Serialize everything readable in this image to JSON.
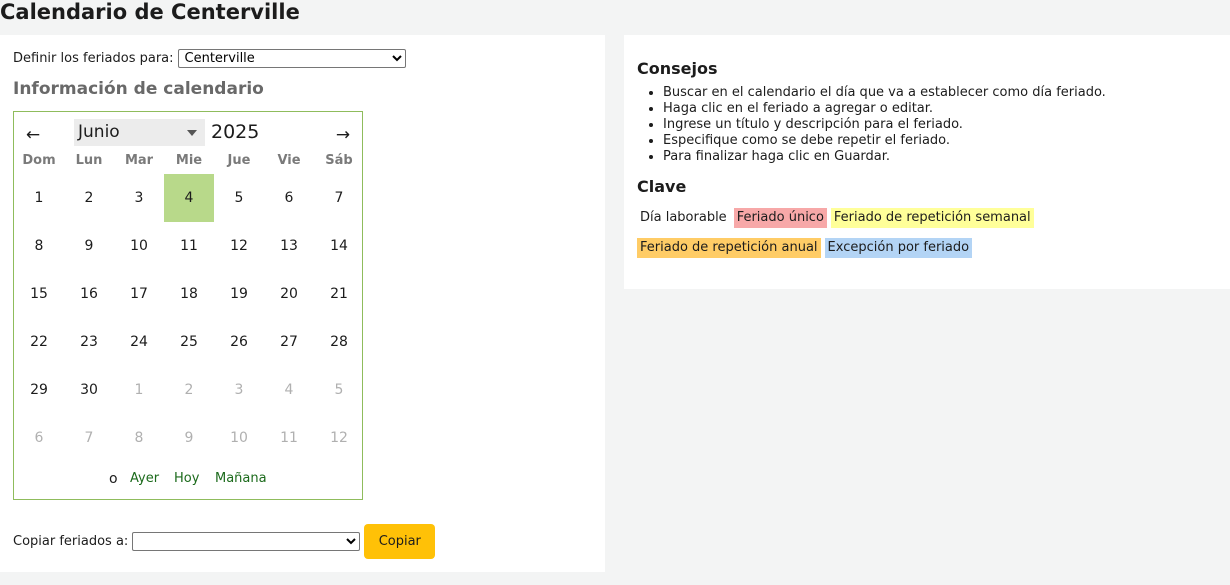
{
  "page_title": "Calendario de Centerville",
  "define": {
    "label": "Definir los feriados para:",
    "selected_library": "Centerville"
  },
  "section_title": "Información de calendario",
  "calendar": {
    "month": "Junio",
    "year": "2025",
    "prev_icon": "arrow-left-icon",
    "next_icon": "arrow-right-icon",
    "weekdays": [
      "Dom",
      "Lun",
      "Mar",
      "Mie",
      "Jue",
      "Vie",
      "Sáb"
    ],
    "weeks": [
      [
        {
          "d": "1"
        },
        {
          "d": "2"
        },
        {
          "d": "3"
        },
        {
          "d": "4",
          "selected": true
        },
        {
          "d": "5"
        },
        {
          "d": "6"
        },
        {
          "d": "7"
        }
      ],
      [
        {
          "d": "8"
        },
        {
          "d": "9"
        },
        {
          "d": "10"
        },
        {
          "d": "11"
        },
        {
          "d": "12"
        },
        {
          "d": "13"
        },
        {
          "d": "14"
        }
      ],
      [
        {
          "d": "15"
        },
        {
          "d": "16"
        },
        {
          "d": "17"
        },
        {
          "d": "18"
        },
        {
          "d": "19"
        },
        {
          "d": "20"
        },
        {
          "d": "21"
        }
      ],
      [
        {
          "d": "22"
        },
        {
          "d": "23"
        },
        {
          "d": "24"
        },
        {
          "d": "25"
        },
        {
          "d": "26"
        },
        {
          "d": "27"
        },
        {
          "d": "28"
        }
      ],
      [
        {
          "d": "29"
        },
        {
          "d": "30"
        },
        {
          "d": "1",
          "other": true
        },
        {
          "d": "2",
          "other": true
        },
        {
          "d": "3",
          "other": true
        },
        {
          "d": "4",
          "other": true
        },
        {
          "d": "5",
          "other": true
        }
      ],
      [
        {
          "d": "6",
          "other": true
        },
        {
          "d": "7",
          "other": true
        },
        {
          "d": "8",
          "other": true
        },
        {
          "d": "9",
          "other": true
        },
        {
          "d": "10",
          "other": true
        },
        {
          "d": "11",
          "other": true
        },
        {
          "d": "12",
          "other": true
        }
      ]
    ],
    "or_label": "o",
    "yesterday": "Ayer",
    "today": "Hoy",
    "tomorrow": "Mañana"
  },
  "copy": {
    "label": "Copiar feriados a:",
    "selected": "",
    "button": "Copiar"
  },
  "tips": {
    "title": "Consejos",
    "items": [
      "Buscar en el calendario el día que va a establecer como día feriado.",
      "Haga clic en el feriado a agregar o editar.",
      "Ingrese un título y descripción para el feriado.",
      "Especifique como se debe repetir el feriado.",
      "Para finalizar haga clic en Guardar."
    ]
  },
  "key": {
    "title": "Clave",
    "working_day": "Día laborable",
    "single_holiday": "Feriado único",
    "weekly_holiday": "Feriado de repetición semanal",
    "yearly_holiday": "Feriado de repetición anual",
    "exception": "Excepción por feriado"
  },
  "colors": {
    "selected_day": "#b5d98a",
    "copy_button": "#ffc107",
    "single_holiday": "#f7a8a8",
    "weekly_holiday": "#ffff99",
    "yearly_holiday": "#ffcc66",
    "exception": "#b3d4f5"
  }
}
